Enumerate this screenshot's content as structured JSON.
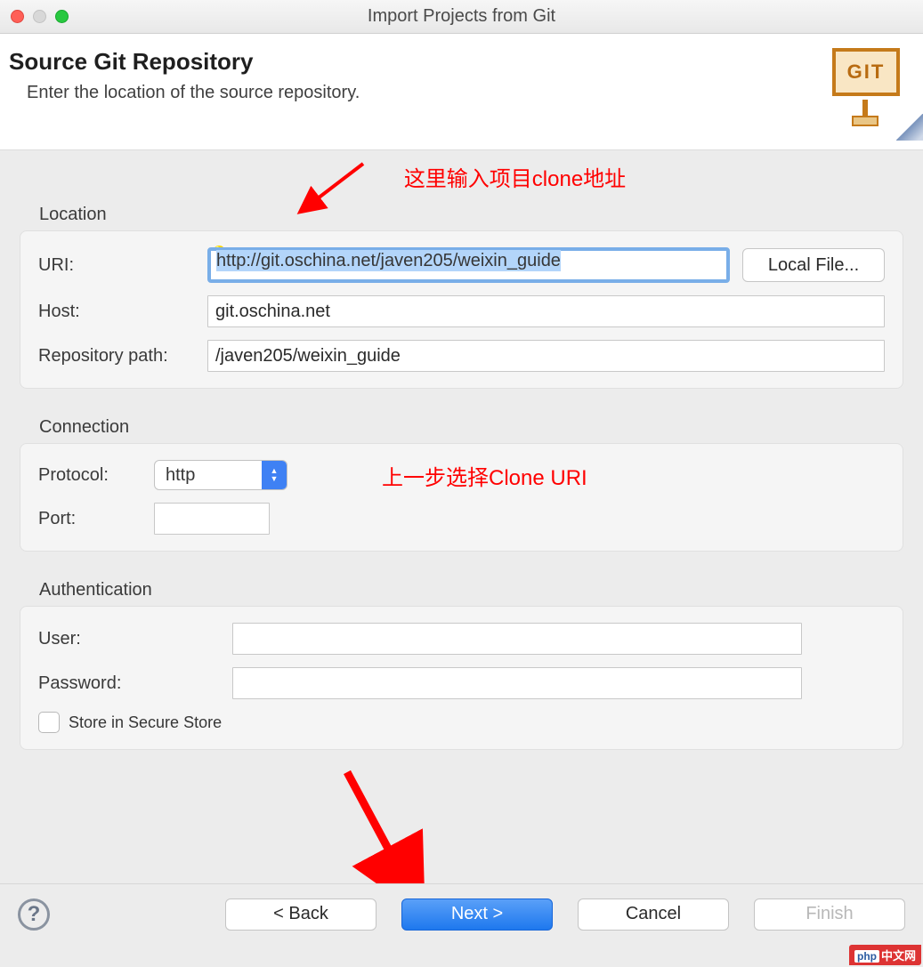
{
  "window": {
    "title": "Import Projects from Git"
  },
  "header": {
    "title": "Source Git Repository",
    "subtitle": "Enter the location of the source repository.",
    "logo_text": "GIT"
  },
  "annotations": {
    "top": "这里输入项目clone地址",
    "mid": "上一步选择Clone URI"
  },
  "location": {
    "section_label": "Location",
    "uri_label": "URI:",
    "uri_value": "http://git.oschina.net/javen205/weixin_guide",
    "local_file_button": "Local File...",
    "host_label": "Host:",
    "host_value": "git.oschina.net",
    "repo_path_label": "Repository path:",
    "repo_path_value": "/javen205/weixin_guide"
  },
  "connection": {
    "section_label": "Connection",
    "protocol_label": "Protocol:",
    "protocol_value": "http",
    "port_label": "Port:",
    "port_value": ""
  },
  "authentication": {
    "section_label": "Authentication",
    "user_label": "User:",
    "user_value": "",
    "password_label": "Password:",
    "password_value": "",
    "store_label": "Store in Secure Store"
  },
  "footer": {
    "back": "< Back",
    "next": "Next >",
    "cancel": "Cancel",
    "finish": "Finish"
  },
  "watermark": {
    "prefix": "php",
    "text": "中文网"
  }
}
